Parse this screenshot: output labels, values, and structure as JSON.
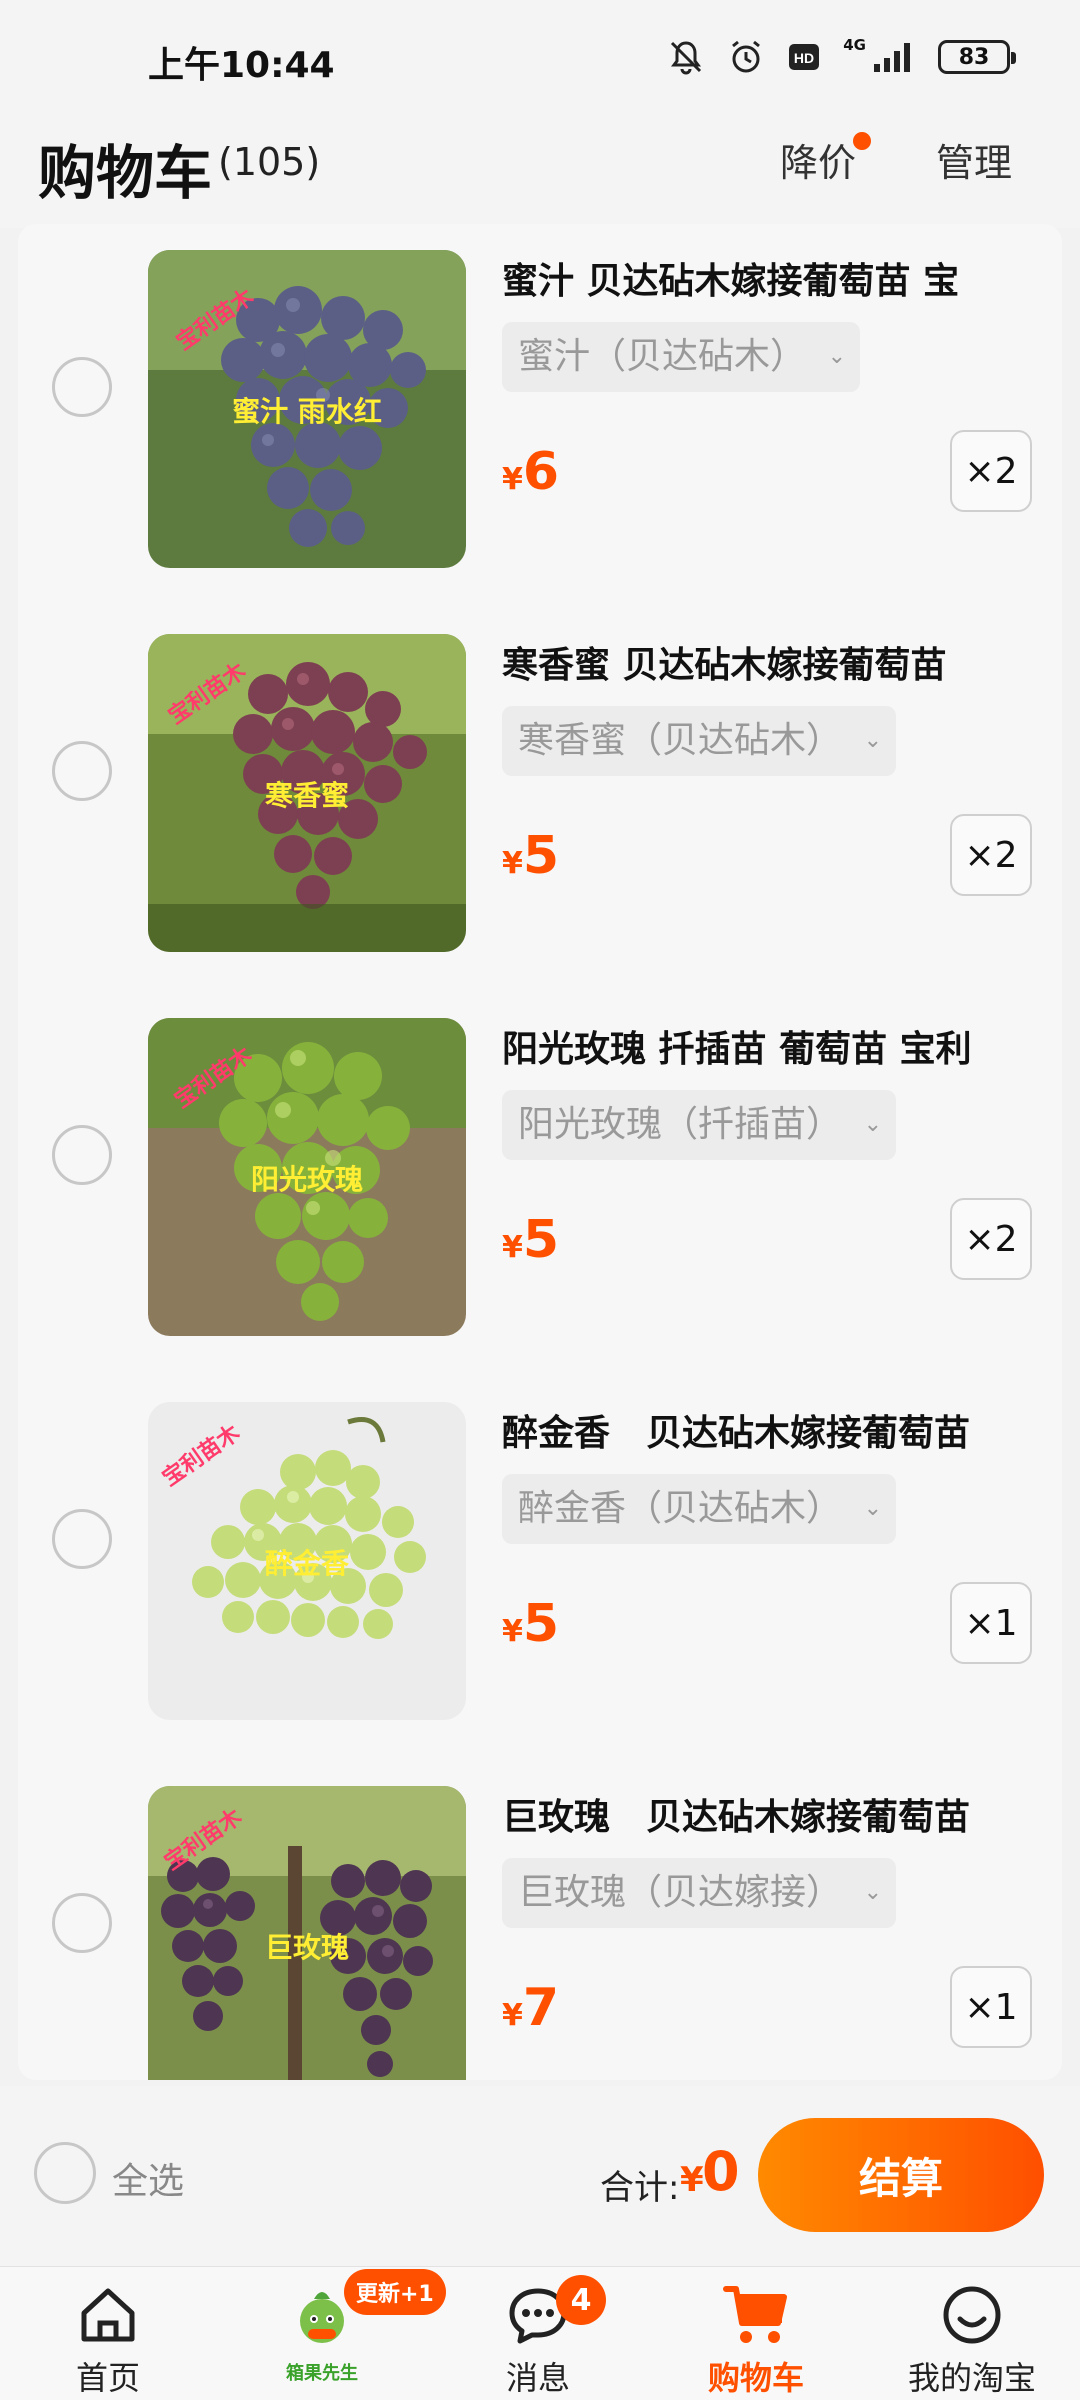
{
  "status": {
    "time": "上午10:44",
    "battery": "83",
    "network": "4G"
  },
  "header": {
    "title": "购物车",
    "count": "(105)",
    "price_drop": "降价",
    "manage": "管理"
  },
  "items": [
    {
      "title": "蜜汁 贝达砧木嫁接葡萄苗 宝",
      "sku": "蜜汁（贝达砧木）",
      "currency": "¥",
      "price": "6",
      "qty": "×2",
      "img_text": "蜜汁 雨水红",
      "brand": "宝利苗木"
    },
    {
      "title": "寒香蜜 贝达砧木嫁接葡萄苗",
      "sku": "寒香蜜（贝达砧木）",
      "currency": "¥",
      "price": "5",
      "qty": "×2",
      "img_text": "寒香蜜",
      "brand": "宝利苗木"
    },
    {
      "title": "阳光玫瑰 扦插苗 葡萄苗 宝利",
      "sku": "阳光玫瑰（扦插苗）",
      "currency": "¥",
      "price": "5",
      "qty": "×2",
      "img_text": "阳光玫瑰",
      "brand": "宝利苗木"
    },
    {
      "title": "醉金香　贝达砧木嫁接葡萄苗",
      "sku": "醉金香（贝达砧木）",
      "currency": "¥",
      "price": "5",
      "qty": "×1",
      "img_text": "醉金香",
      "brand": "宝利苗木"
    },
    {
      "title": "巨玫瑰　贝达砧木嫁接葡萄苗",
      "sku": "巨玫瑰（贝达嫁接）",
      "currency": "¥",
      "price": "7",
      "qty": "×1",
      "img_text": "巨玫瑰",
      "brand": "宝利苗木"
    }
  ],
  "summary": {
    "select_all": "全选",
    "total_label": "合计:",
    "total_currency": "¥",
    "total_value": "0",
    "checkout": "结算"
  },
  "tabs": {
    "home": "首页",
    "mascot": "箱果先生",
    "mascot_badge": "更新+1",
    "messages": "消息",
    "messages_badge": "4",
    "cart": "购物车",
    "mine": "我的淘宝"
  },
  "colors": {
    "accent": "#ff5000",
    "accent_light": "#ff8a00"
  },
  "icons": [
    "mute-icon",
    "alarm-icon",
    "hd-icon",
    "signal-icon",
    "battery-icon",
    "home-icon",
    "mascot-icon",
    "message-icon",
    "cart-icon",
    "smile-icon",
    "chevron-down-icon"
  ]
}
